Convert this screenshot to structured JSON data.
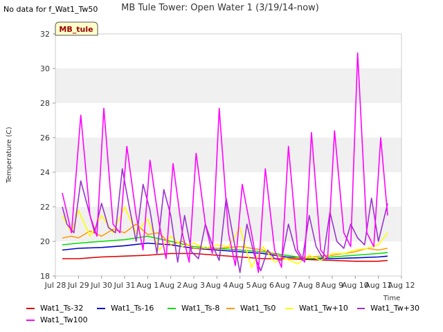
{
  "no_data_text": "No data for f_Wat1_Tw50",
  "chart_data": {
    "type": "line",
    "title": "MB Tule Tower: Open Water 1 (3/19/14-now)",
    "xlabel": "Time",
    "ylabel": "Temperature (C)",
    "ylim": [
      18,
      32
    ],
    "xlim": [
      0,
      15
    ],
    "yticks": [
      18,
      20,
      22,
      24,
      26,
      28,
      30,
      32
    ],
    "xtick_labels": [
      "Jul 28",
      "Jul 29",
      "Jul 30",
      "Jul 31",
      "Aug 1",
      "Aug 2",
      "Aug 3",
      "Aug 4",
      "Aug 5",
      "Aug 6",
      "Aug 7",
      "Aug 8",
      "Aug 9",
      "Aug 10",
      "Aug 11",
      "Aug 12"
    ],
    "grid": "horizontal bands",
    "station_label": "MB_tule",
    "legend_position": "bottom",
    "series": [
      {
        "name": "Wat1_Ts-32",
        "color": "#dd0000",
        "x": [
          0.3,
          1,
          2,
          3,
          4,
          5,
          6,
          7,
          8,
          9,
          10,
          11,
          12,
          13,
          14,
          14.4
        ],
        "y": [
          19.0,
          19.0,
          19.1,
          19.15,
          19.2,
          19.3,
          19.3,
          19.2,
          19.1,
          19.0,
          19.0,
          18.95,
          18.9,
          18.85,
          18.85,
          18.9
        ]
      },
      {
        "name": "Wat1_Ts-16",
        "color": "#0000cc",
        "x": [
          0.3,
          1,
          2,
          3,
          4,
          5,
          6,
          7,
          8,
          9,
          10,
          11,
          12,
          13,
          14,
          14.4
        ],
        "y": [
          19.5,
          19.6,
          19.65,
          19.75,
          19.9,
          19.8,
          19.6,
          19.5,
          19.4,
          19.3,
          19.1,
          19.0,
          19.0,
          19.05,
          19.1,
          19.15
        ]
      },
      {
        "name": "Wat1_Ts-8",
        "color": "#00dd00",
        "x": [
          0.3,
          1,
          2,
          3,
          4,
          5,
          6,
          7,
          8,
          9,
          10,
          11,
          12,
          13,
          14,
          14.4
        ],
        "y": [
          19.8,
          19.9,
          20.0,
          20.1,
          20.3,
          20.0,
          19.7,
          19.6,
          19.5,
          19.4,
          19.2,
          19.0,
          19.1,
          19.2,
          19.3,
          19.35
        ]
      },
      {
        "name": "Wat1_Ts0",
        "color": "#ff9900",
        "x": [
          0.3,
          0.7,
          1,
          1.5,
          2,
          2.5,
          3,
          3.5,
          4,
          4.5,
          5,
          5.5,
          6,
          7,
          8,
          9,
          10,
          11,
          12,
          13,
          13.5,
          14,
          14.4
        ],
        "y": [
          20.2,
          20.3,
          20.2,
          20.6,
          20.3,
          20.7,
          20.5,
          21.0,
          20.4,
          20.5,
          19.8,
          20.0,
          19.6,
          19.6,
          19.7,
          19.5,
          19.0,
          19.1,
          19.2,
          19.4,
          19.6,
          19.5,
          19.6
        ]
      },
      {
        "name": "Wat1_Tw+10",
        "color": "#ffff00",
        "x": [
          0.3,
          0.7,
          1,
          1.5,
          2,
          2.5,
          3,
          3.5,
          4,
          4.5,
          5,
          5.5,
          6,
          6.5,
          7,
          7.5,
          8,
          8.5,
          9,
          9.5,
          10,
          10.5,
          11,
          11.5,
          12,
          12.5,
          13,
          13.5,
          14,
          14.4
        ],
        "y": [
          21.5,
          20.5,
          21.8,
          20.3,
          21.5,
          20.5,
          22.0,
          20.5,
          21.3,
          19.5,
          20.3,
          19.7,
          19.9,
          19.6,
          19.8,
          19.7,
          20.8,
          18.5,
          19.7,
          18.8,
          19.0,
          18.7,
          19.2,
          18.9,
          19.3,
          19.3,
          19.5,
          19.6,
          19.8,
          20.5
        ]
      },
      {
        "name": "Wat1_Tw+30",
        "color": "#9933cc",
        "x": [
          0.3,
          0.5,
          0.8,
          1.1,
          1.4,
          1.7,
          2.0,
          2.3,
          2.6,
          2.9,
          3.2,
          3.5,
          3.8,
          4.1,
          4.4,
          4.7,
          5.0,
          5.3,
          5.6,
          5.9,
          6.2,
          6.5,
          6.8,
          7.1,
          7.4,
          7.7,
          8.0,
          8.3,
          8.6,
          8.9,
          9.2,
          9.5,
          9.8,
          10.1,
          10.4,
          10.7,
          11.0,
          11.3,
          11.6,
          11.9,
          12.2,
          12.5,
          12.8,
          13.1,
          13.4,
          13.7,
          14.0,
          14.4
        ],
        "y": [
          22.0,
          21.0,
          20.5,
          23.5,
          22.0,
          20.5,
          22.2,
          20.8,
          20.5,
          24.2,
          22.0,
          20.0,
          23.3,
          21.8,
          19.3,
          23.0,
          21.5,
          18.8,
          21.5,
          19.4,
          19.0,
          21.0,
          19.8,
          18.9,
          22.5,
          20.3,
          18.2,
          21.0,
          19.3,
          18.3,
          19.5,
          19.0,
          18.9,
          21.0,
          19.5,
          18.9,
          21.5,
          19.7,
          19.0,
          21.7,
          20.0,
          19.6,
          21.0,
          20.2,
          19.8,
          22.5,
          20.0,
          22.2
        ]
      },
      {
        "name": "Wat1_Tw100",
        "color": "#ff00ff",
        "x": [
          0.3,
          0.7,
          1.1,
          1.5,
          1.8,
          2.1,
          2.5,
          2.8,
          3.1,
          3.5,
          3.8,
          4.1,
          4.5,
          4.8,
          5.1,
          5.5,
          5.8,
          6.1,
          6.5,
          6.8,
          7.1,
          7.5,
          7.8,
          8.1,
          8.5,
          8.8,
          9.1,
          9.5,
          9.8,
          10.1,
          10.5,
          10.8,
          11.1,
          11.5,
          11.8,
          12.1,
          12.5,
          12.8,
          13.1,
          13.5,
          13.8,
          14.1,
          14.4
        ],
        "y": [
          22.8,
          20.5,
          27.3,
          21.5,
          20.3,
          27.7,
          21.0,
          20.5,
          25.5,
          21.5,
          19.5,
          24.7,
          21.0,
          19.0,
          24.5,
          20.5,
          18.8,
          25.1,
          21.0,
          19.3,
          27.7,
          20.5,
          18.6,
          23.3,
          20.5,
          18.2,
          24.2,
          19.5,
          18.5,
          25.5,
          19.5,
          18.8,
          26.3,
          19.5,
          19.0,
          26.4,
          20.5,
          19.7,
          30.9,
          20.5,
          19.7,
          26.0,
          21.5
        ]
      }
    ]
  }
}
